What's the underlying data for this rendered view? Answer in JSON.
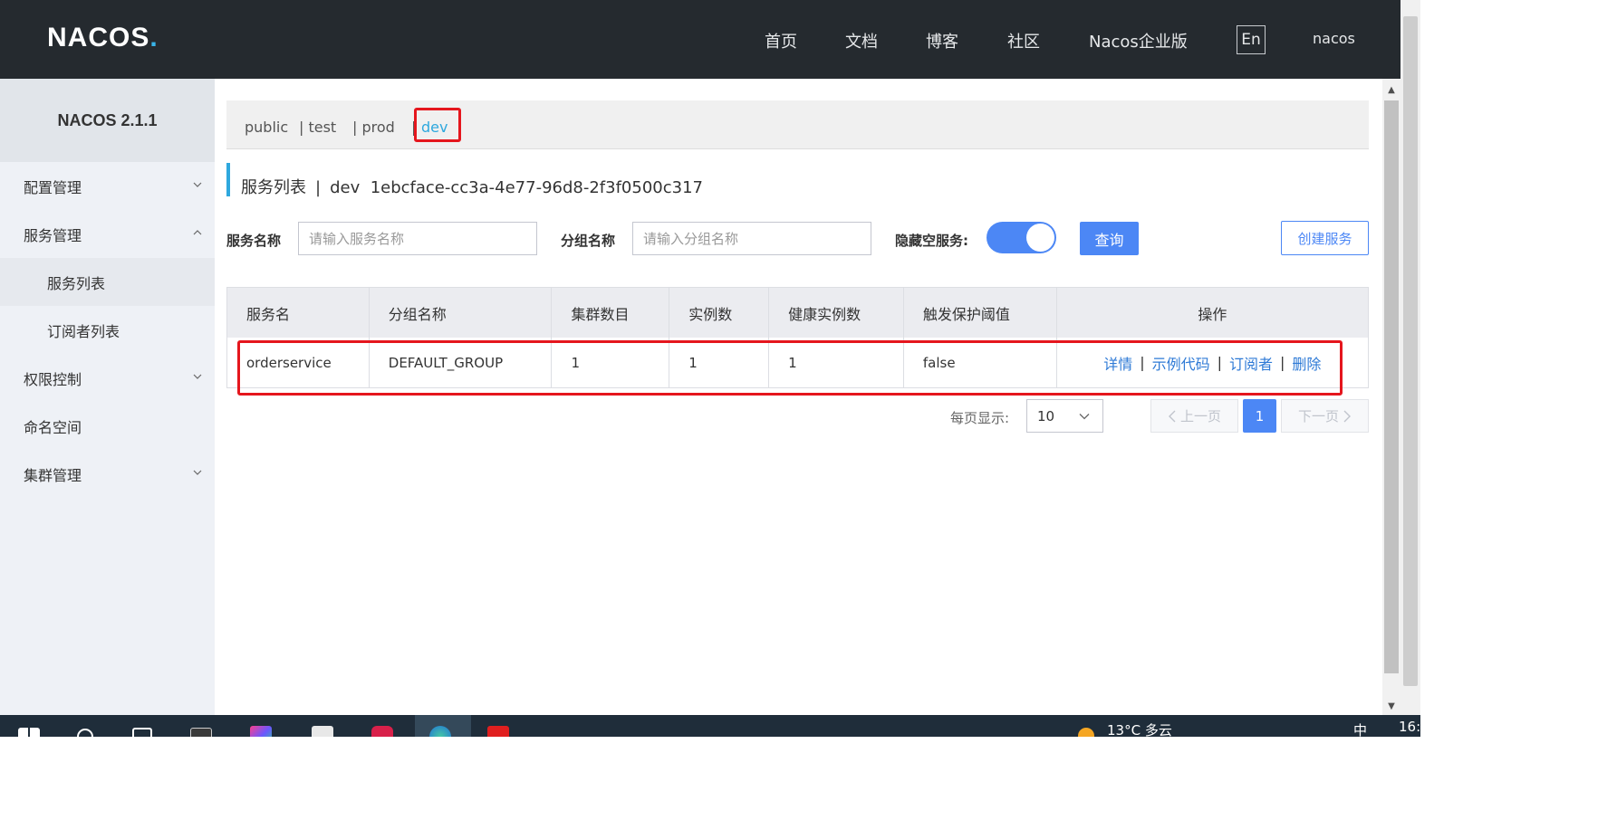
{
  "header": {
    "logo": "NACOS",
    "nav": [
      "首页",
      "文档",
      "博客",
      "社区",
      "Nacos企业版"
    ],
    "lang": "En",
    "user": "nacos"
  },
  "sidebar": {
    "version": "NACOS 2.1.1",
    "items": [
      {
        "label": "配置管理"
      },
      {
        "label": "服务管理"
      },
      {
        "label": "服务列表"
      },
      {
        "label": "订阅者列表"
      },
      {
        "label": "权限控制"
      },
      {
        "label": "命名空间"
      },
      {
        "label": "集群管理"
      }
    ]
  },
  "namespaces": [
    "public",
    "| test",
    "| prod",
    "|",
    "dev"
  ],
  "page": {
    "title": "服务列表",
    "sep": "|",
    "ns_name": "dev",
    "ns_id": "1ebcface-cc3a-4e77-96d8-2f3f0500c317"
  },
  "filters": {
    "service_label": "服务名称",
    "service_placeholder": "请输入服务名称",
    "group_label": "分组名称",
    "group_placeholder": "请输入分组名称",
    "hide_empty_label": "隐藏空服务:",
    "hide_empty": true,
    "query_label": "查询",
    "create_label": "创建服务"
  },
  "table": {
    "headers": [
      "服务名",
      "分组名称",
      "集群数目",
      "实例数",
      "健康实例数",
      "触发保护阈值",
      "操作"
    ],
    "rows": [
      {
        "service": "orderservice",
        "group": "DEFAULT_GROUP",
        "clusters": "1",
        "instances": "1",
        "healthy": "1",
        "protect": "false"
      }
    ],
    "ops": [
      "详情",
      "示例代码",
      "订阅者",
      "删除"
    ],
    "op_sep": "|"
  },
  "pager": {
    "label": "每页显示:",
    "page_size": "10",
    "prev": "上一页",
    "current": "1",
    "next": "下一页"
  },
  "taskbar": {
    "weather": "13°C 多云",
    "ime": "中",
    "clock": "16:"
  },
  "colors": {
    "header_bg": "#252a2f",
    "accent": "#4c87f5",
    "link": "#2e7ad6",
    "highlight": "#e5161d",
    "ns_active": "#2ea8de"
  }
}
